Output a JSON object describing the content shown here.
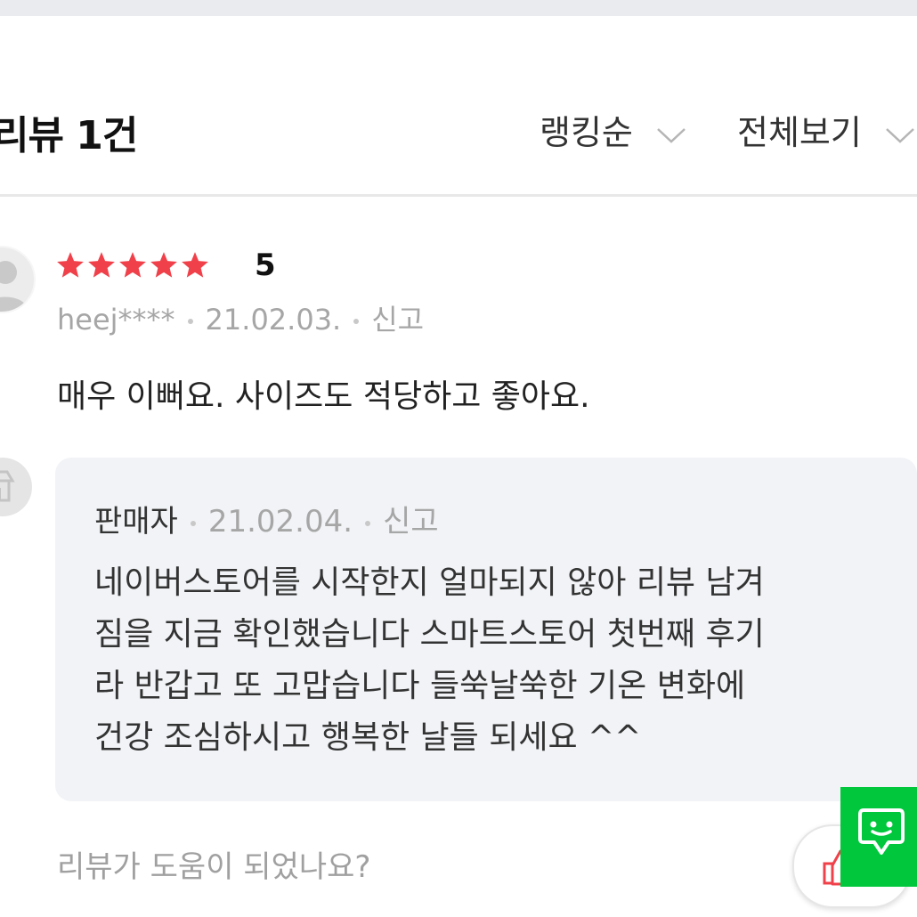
{
  "header": {
    "title": "리뷰 1건",
    "sort_label": "랭킹순",
    "filter_label": "전체보기"
  },
  "review": {
    "rating": "5",
    "star_count": 5,
    "star_color": "#f0414a",
    "author": "heej****",
    "date": "21.02.03.",
    "report_label": "신고",
    "text": "매우 이뻐요.  사이즈도 적당하고 좋아요."
  },
  "seller_reply": {
    "author": "판매자",
    "date": "21.02.04.",
    "report_label": "신고",
    "lines": [
      "네이버스토어를 시작한지 얼마되지 않아 리뷰 남겨",
      "짐을 지금 확인했습니다 스마트스토어 첫번째 후기",
      "라 반갑고 또 고맙습니다 들쑥날쑥한 기온 변화에",
      "건강 조심하시고 행복한 날들 되세요 ^^"
    ]
  },
  "footer": {
    "helpful_question": "리뷰가 도움이 되었나요?"
  },
  "icons": {
    "user_avatar": "user-avatar-icon",
    "seller_avatar": "store-icon",
    "like": "thumbs-up-icon",
    "chat": "talktalk-chat-icon",
    "chevron": "chevron-down-icon"
  },
  "colors": {
    "accent_green": "#00c73c",
    "star_red": "#f0414a",
    "reply_bg": "#f1f3f6"
  }
}
